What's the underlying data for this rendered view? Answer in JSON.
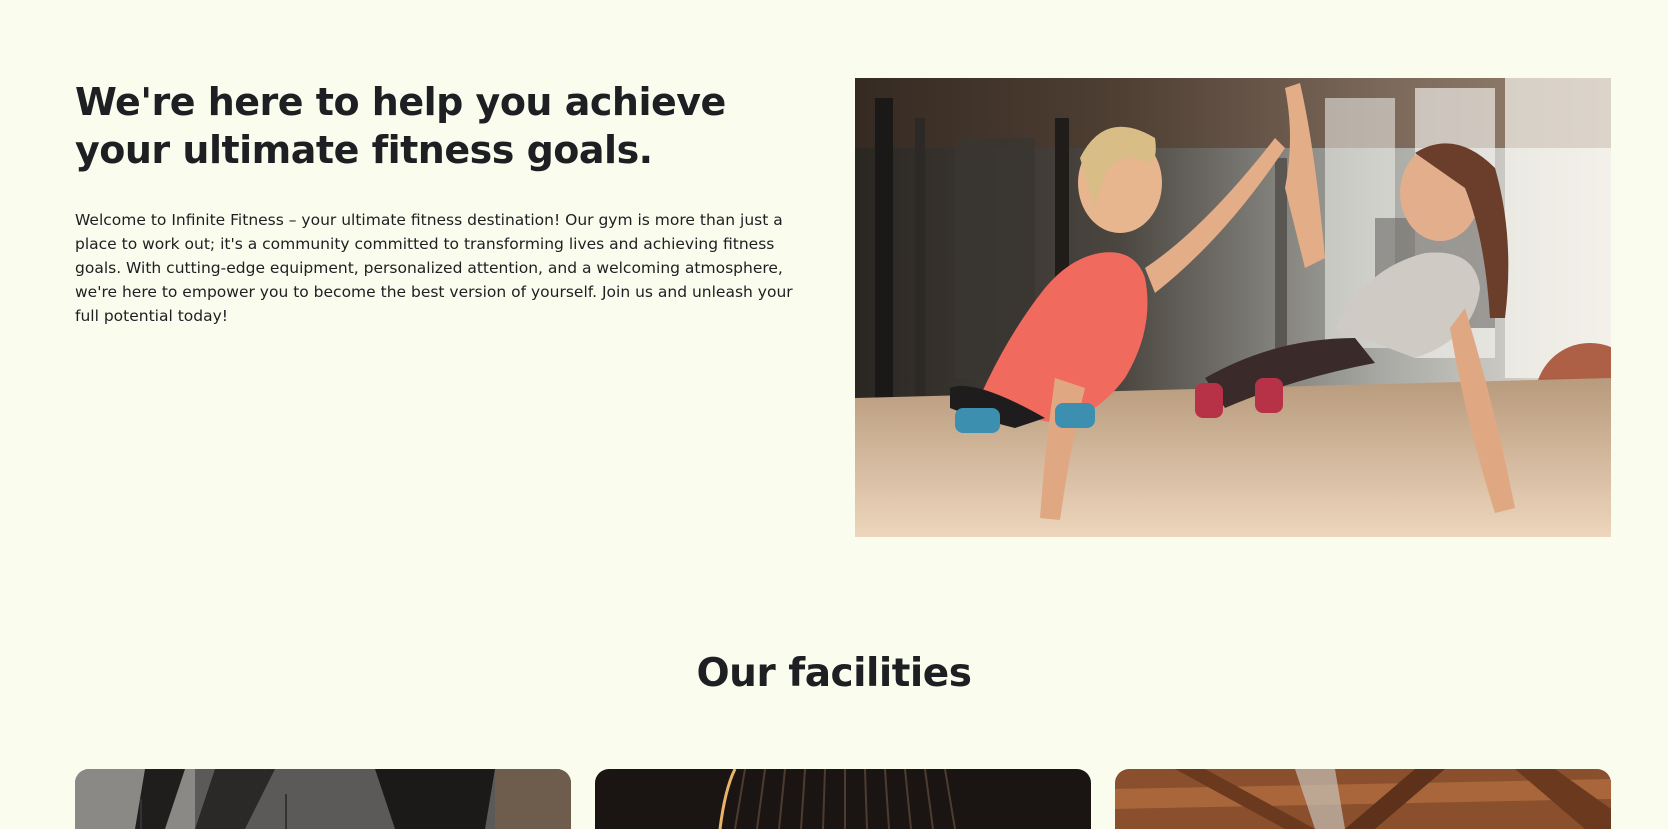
{
  "about": {
    "heading": "We're here to help you achieve your ultimate fitness goals.",
    "body": "Welcome to Infinite Fitness – your ultimate fitness destination! Our gym is more than just a place to work out; it's a community committed to transforming lives and achieving fitness goals. With cutting-edge equipment, personalized attention, and a welcoming atmosphere, we're here to empower you to become the best version of yourself. Join us and unleash your full potential today!"
  },
  "facilities": {
    "heading": "Our facilities",
    "cards": [
      {
        "image": "gym-interior-photo"
      },
      {
        "image": "dark-studio-photo"
      },
      {
        "image": "wooden-ceiling-photo"
      }
    ]
  },
  "colors": {
    "background": "#fafcee",
    "text": "#1d1f22"
  }
}
